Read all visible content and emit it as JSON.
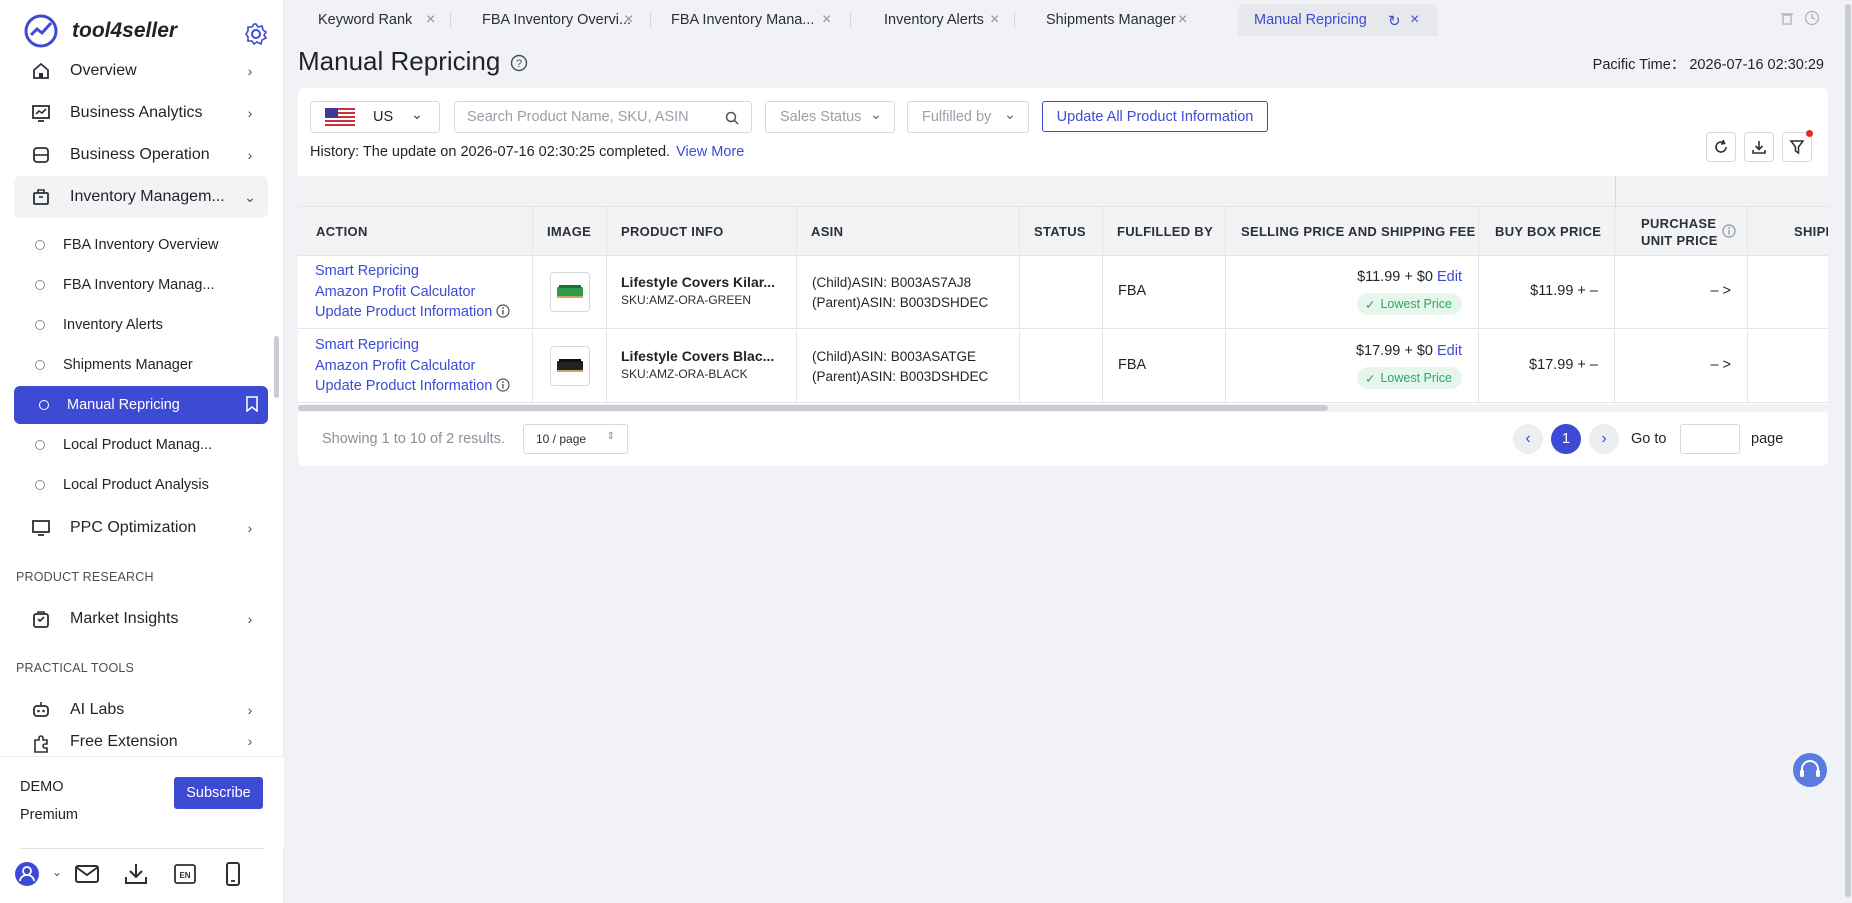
{
  "app": {
    "name": "tool4seller"
  },
  "sidebar": {
    "items": [
      {
        "label": "Overview",
        "icon": "home-icon"
      },
      {
        "label": "Business Analytics",
        "icon": "chart-icon"
      },
      {
        "label": "Business Operation",
        "icon": "store-icon"
      },
      {
        "label": "Inventory Managem...",
        "icon": "box-icon"
      }
    ],
    "inventory_sub": [
      {
        "label": "FBA Inventory Overview"
      },
      {
        "label": "FBA Inventory Manag..."
      },
      {
        "label": "Inventory Alerts"
      },
      {
        "label": "Shipments Manager"
      },
      {
        "label": "Manual Repricing"
      },
      {
        "label": "Local Product Manag..."
      },
      {
        "label": "Local Product Analysis"
      }
    ],
    "ppc": {
      "label": "PPC Optimization"
    },
    "section_research": "PRODUCT RESEARCH",
    "market": {
      "label": "Market Insights"
    },
    "section_tools": "PRACTICAL TOOLS",
    "ai": {
      "label": "AI Labs"
    },
    "ext": {
      "label": "Free Extension"
    },
    "plan": {
      "name": "DEMO",
      "tier": "Premium",
      "subscribe": "Subscribe"
    }
  },
  "tabs": [
    {
      "label": "Keyword Rank"
    },
    {
      "label": "FBA Inventory Overvi..."
    },
    {
      "label": "FBA Inventory Mana..."
    },
    {
      "label": "Inventory Alerts"
    },
    {
      "label": "Shipments Manager"
    },
    {
      "label": "Manual Repricing"
    }
  ],
  "page": {
    "title": "Manual Repricing",
    "pacific_time": "Pacific Time： 2026-07-16 02:30:29"
  },
  "filters": {
    "marketplace": "US",
    "search_placeholder": "Search Product Name, SKU, ASIN",
    "sales_status": "Sales Status",
    "fulfilled_by": "Fulfilled by",
    "update_all": "Update All Product Information"
  },
  "history": {
    "text": "History:  The update on 2026-07-16 02:30:25 completed.",
    "link": "View More"
  },
  "table": {
    "headers": {
      "action": "ACTION",
      "image": "IMAGE",
      "product_info": "PRODUCT INFO",
      "asin": "ASIN",
      "status": "STATUS",
      "fulfilled_by": "FULFILLED BY",
      "selling_price": "SELLING PRICE AND SHIPPING FEE",
      "buy_box": "BUY BOX PRICE",
      "purchase_unit_1": "PURCHASE",
      "purchase_unit_2": "UNIT PRICE",
      "shipping": "SHIPP"
    },
    "rows": [
      {
        "action1": "Smart Repricing",
        "action2": "Amazon Profit Calculator",
        "action3": "Update Product Information",
        "name": "Lifestyle Covers Kilar...",
        "sku": "SKU:AMZ-ORA-GREEN",
        "child_asin": "(Child)ASIN: B003AS7AJ8",
        "parent_asin": "(Parent)ASIN: B003DSHDEC",
        "fulfilled": "FBA",
        "price": "$11.99 + $0",
        "edit": "Edit",
        "badge": "Lowest Price",
        "buybox": "$11.99 + –",
        "purchase": "– >",
        "swatch": "#2e9c4a"
      },
      {
        "action1": "Smart Repricing",
        "action2": "Amazon Profit Calculator",
        "action3": "Update Product Information",
        "name": "Lifestyle Covers Blac...",
        "sku": "SKU:AMZ-ORA-BLACK",
        "child_asin": "(Child)ASIN: B003ASATGE",
        "parent_asin": "(Parent)ASIN: B003DSHDEC",
        "fulfilled": "FBA",
        "price": "$17.99 + $0",
        "edit": "Edit",
        "badge": "Lowest Price",
        "buybox": "$17.99 + –",
        "purchase": "– >",
        "swatch": "#222222"
      }
    ]
  },
  "pagination": {
    "summary": "Showing 1 to 10 of 2 results.",
    "page_size": "10 / page",
    "current": "1",
    "goto": "Go to",
    "page": "page"
  },
  "colors": {
    "accent": "#3d4bd4",
    "success": "#2fa866"
  }
}
